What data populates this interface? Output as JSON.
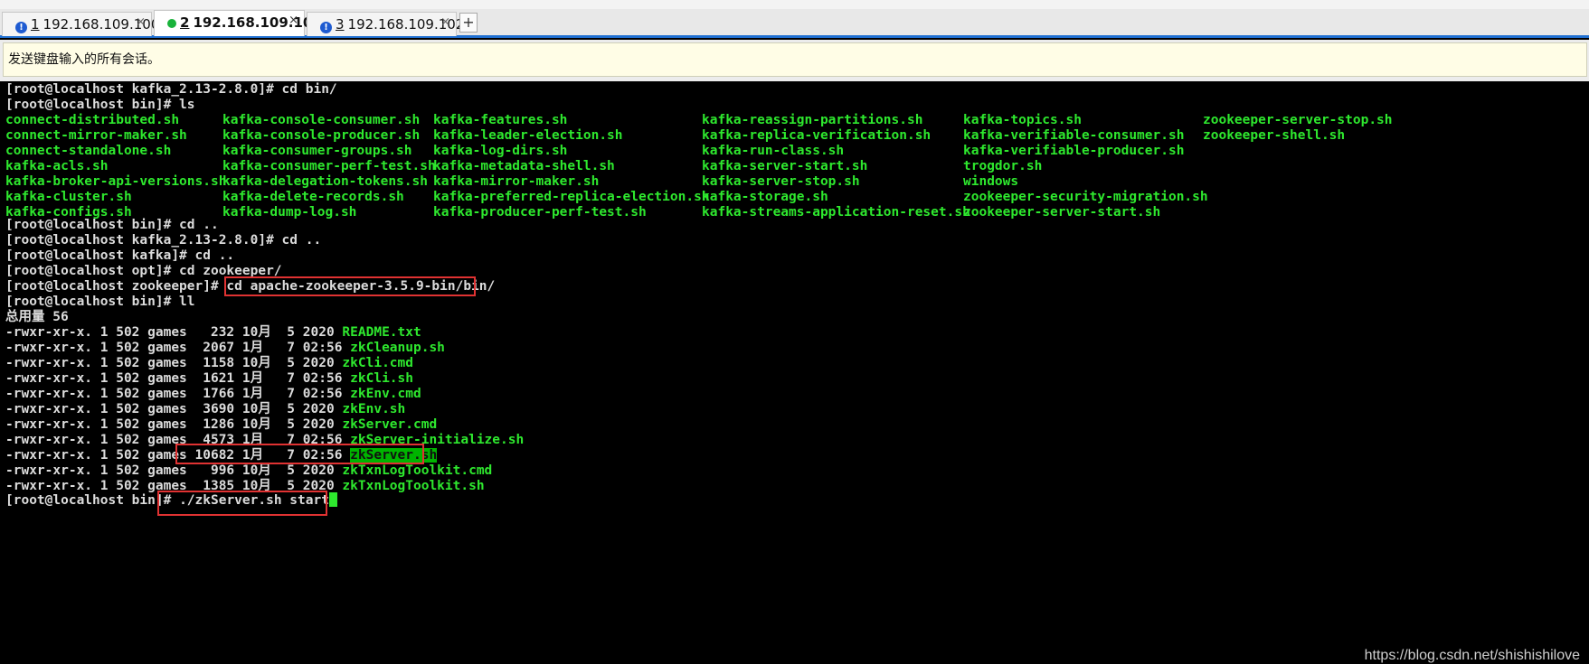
{
  "tabs": [
    {
      "num": "1",
      "label": "192.168.109.100",
      "status": "warn",
      "close": "×"
    },
    {
      "num": "2",
      "label": "192.168.109.101",
      "status": "ok",
      "close": "×"
    },
    {
      "num": "3",
      "label": "192.168.109.102",
      "status": "warn",
      "close": "×"
    }
  ],
  "add_tab": "+",
  "sendbar": {
    "text": "发送键盘输入的所有会话。"
  },
  "terminal": {
    "lines_top": [
      "[root@localhost kafka_2.13-2.8.0]# cd bin/",
      "[root@localhost bin]# ls"
    ],
    "ls_columns": [
      [
        "connect-distributed.sh",
        "connect-mirror-maker.sh",
        "connect-standalone.sh",
        "kafka-acls.sh",
        "kafka-broker-api-versions.sh",
        "kafka-cluster.sh",
        "kafka-configs.sh"
      ],
      [
        "kafka-console-consumer.sh",
        "kafka-console-producer.sh",
        "kafka-consumer-groups.sh",
        "kafka-consumer-perf-test.sh",
        "kafka-delegation-tokens.sh",
        "kafka-delete-records.sh",
        "kafka-dump-log.sh"
      ],
      [
        "kafka-features.sh",
        "kafka-leader-election.sh",
        "kafka-log-dirs.sh",
        "kafka-metadata-shell.sh",
        "kafka-mirror-maker.sh",
        "kafka-preferred-replica-election.sh",
        "kafka-producer-perf-test.sh"
      ],
      [
        "kafka-reassign-partitions.sh",
        "kafka-replica-verification.sh",
        "kafka-run-class.sh",
        "kafka-server-start.sh",
        "kafka-server-stop.sh",
        "kafka-storage.sh",
        "kafka-streams-application-reset.sh"
      ],
      [
        "kafka-topics.sh",
        "kafka-verifiable-consumer.sh",
        "kafka-verifiable-producer.sh",
        "trogdor.sh",
        "windows",
        "zookeeper-security-migration.sh",
        "zookeeper-server-start.sh"
      ],
      [
        "zookeeper-server-stop.sh",
        "zookeeper-shell.sh"
      ]
    ],
    "lines_mid": [
      "[root@localhost bin]# cd ..",
      "[root@localhost kafka_2.13-2.8.0]# cd ..",
      "[root@localhost kafka]# cd ..",
      "[root@localhost opt]# cd zookeeper/"
    ],
    "cd_prompt": "[root@localhost zookeeper]# cd ",
    "cd_path": "apache-zookeeper-3.5.9-bin/bin/",
    "ll_cmd": "[root@localhost bin]# ll",
    "total": "总用量 56",
    "ll_rows": [
      {
        "meta": "-rwxr-xr-x. 1 502 games   232 10月  5 2020 ",
        "name": "README.txt"
      },
      {
        "meta": "-rwxr-xr-x. 1 502 games  2067 1月   7 02:56 ",
        "name": "zkCleanup.sh"
      },
      {
        "meta": "-rwxr-xr-x. 1 502 games  1158 10月  5 2020 ",
        "name": "zkCli.cmd"
      },
      {
        "meta": "-rwxr-xr-x. 1 502 games  1621 1月   7 02:56 ",
        "name": "zkCli.sh"
      },
      {
        "meta": "-rwxr-xr-x. 1 502 games  1766 1月   7 02:56 ",
        "name": "zkEnv.cmd"
      },
      {
        "meta": "-rwxr-xr-x. 1 502 games  3690 10月  5 2020 ",
        "name": "zkEnv.sh"
      },
      {
        "meta": "-rwxr-xr-x. 1 502 games  1286 10月  5 2020 ",
        "name": "zkServer.cmd"
      },
      {
        "meta": "-rwxr-xr-x. 1 502 games  4573 1月   7 02:56 ",
        "name": "zkServer-initialize.sh"
      },
      {
        "meta": "-rwxr-xr-x. 1 502 games 10682 1月   7 02:56 ",
        "name": "zkServer.sh"
      },
      {
        "meta": "-rwxr-xr-x. 1 502 games   996 10月  5 2020 ",
        "name": "zkTxnLogToolkit.cmd"
      },
      {
        "meta": "-rwxr-xr-x. 1 502 games  1385 10月  5 2020 ",
        "name": "zkTxnLogToolkit.sh"
      }
    ],
    "final_prompt": "[root@localhost bin]# ",
    "final_cmd": "./zkServer.sh start"
  },
  "watermark": "https://blog.csdn.net/shishishilove",
  "colors": {
    "exec_green": "#2ee82e",
    "dir_blue": "#2929ff",
    "highlight_box": "#e03232",
    "tab_accent": "#1f6fd1"
  }
}
